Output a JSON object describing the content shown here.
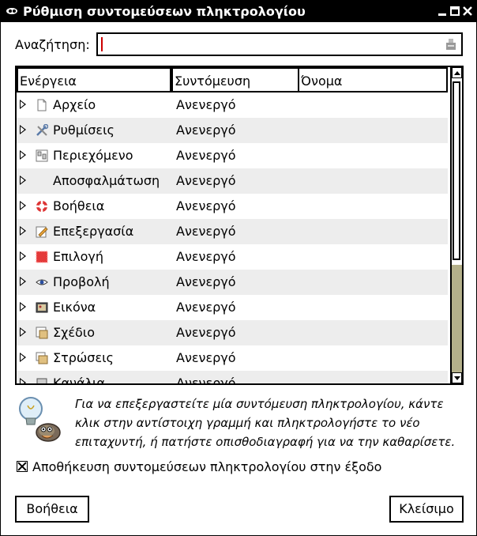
{
  "window": {
    "title": "Ρύθμιση συντομεύσεων πληκτρολογίου",
    "controls": [
      "minimize-icon",
      "maximize-icon",
      "close-icon"
    ]
  },
  "search": {
    "label": "Αναζήτηση:",
    "value": ""
  },
  "table": {
    "columns": [
      "Ενέργεια",
      "Συντόμευση",
      "Όνομα"
    ],
    "rows": [
      {
        "icon": "document-icon",
        "label": "Αρχείο",
        "shortcut": "Ανενεργό"
      },
      {
        "icon": "preferences-icon",
        "label": "Ρυθμίσεις",
        "shortcut": "Ανενεργό"
      },
      {
        "icon": "context-icon",
        "label": "Περιεχόμενο",
        "shortcut": "Ανενεργό"
      },
      {
        "icon": "",
        "label": "Αποσφαλμάτωση",
        "shortcut": "Ανενεργό"
      },
      {
        "icon": "help-lifebuoy-icon",
        "label": "Βοήθεια",
        "shortcut": "Ανενεργό"
      },
      {
        "icon": "edit-icon",
        "label": "Επεξεργασία",
        "shortcut": "Ανενεργό"
      },
      {
        "icon": "selection-icon",
        "label": "Επιλογή",
        "shortcut": "Ανενεργό"
      },
      {
        "icon": "eye-icon",
        "label": "Προβολή",
        "shortcut": "Ανενεργό"
      },
      {
        "icon": "image-icon",
        "label": "Εικόνα",
        "shortcut": "Ανενεργό"
      },
      {
        "icon": "drawable-icon",
        "label": "Σχέδιο",
        "shortcut": "Ανενεργό"
      },
      {
        "icon": "layers-icon",
        "label": "Στρώσεις",
        "shortcut": "Ανενεργό"
      },
      {
        "icon": "channels-icon",
        "label": "Κανάλια",
        "shortcut": "Ανενεργό"
      }
    ]
  },
  "hint": {
    "text": "Για να επεξεργαστείτε μία συντόμευση πληκτρολογίου, κάντε κλικ στην αντίστοιχη γραμμή και πληκτρολογήστε το νέο επιταχυντή, ή πατήστε οπισθοδιαγραφή για να την καθαρίσετε.",
    "icon": "gimp-tip-icon"
  },
  "save_on_exit": {
    "label": "Αποθήκευση συντομεύσεων πληκτρολογίου στην έξοδο",
    "checked": true
  },
  "buttons": {
    "help": "Βοήθεια",
    "close": "Κλείσιμο"
  }
}
